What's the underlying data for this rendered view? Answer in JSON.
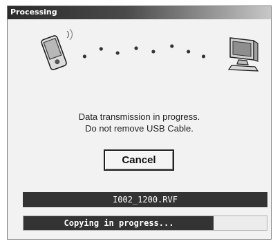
{
  "window": {
    "title": "Processing"
  },
  "illustration": {
    "left_icon": "handheld-device-wireless-icon",
    "right_icon": "desktop-computer-icon"
  },
  "message": {
    "line1": "Data transmission in progress.",
    "line2": "Do not remove USB Cable."
  },
  "buttons": {
    "cancel_label": "Cancel"
  },
  "file": {
    "name": "I002_1200.RVF"
  },
  "progress": {
    "label": "Copying in progress...",
    "fraction": 0.78
  },
  "colors": {
    "bar": "#333333",
    "track": "#ececec",
    "window_bg": "#f2f2f2"
  }
}
